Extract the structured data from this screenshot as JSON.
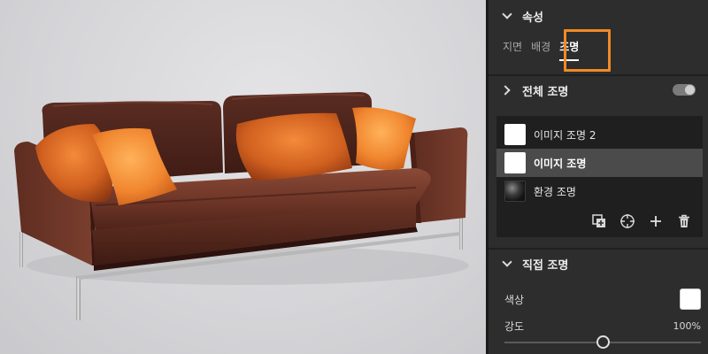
{
  "viewport": {
    "scene": "3d-sofa-preview",
    "background_color": "#d8d8db"
  },
  "panel": {
    "properties": {
      "title": "속성"
    },
    "tabs": [
      {
        "label": "지면",
        "active": false
      },
      {
        "label": "배경",
        "active": false
      },
      {
        "label": "조명",
        "active": true
      }
    ],
    "highlight_color": "#f08a24",
    "global_lighting": {
      "title": "전체 조명",
      "enabled": true
    },
    "lights": [
      {
        "label": "이미지 조명 2",
        "thumb": "white",
        "selected": false
      },
      {
        "label": "이미지 조명",
        "thumb": "white",
        "selected": true
      },
      {
        "label": "환경 조명",
        "thumb": "environment-sphere",
        "selected": false
      }
    ],
    "list_tools": [
      "add-layer-icon",
      "target-icon",
      "plus-icon",
      "trash-icon"
    ],
    "direct_light": {
      "title": "직접 조명",
      "color_label": "색상",
      "color_value": "#ffffff",
      "intensity_label": "강도",
      "intensity_value": "100%",
      "intensity_fraction": 0.5
    }
  }
}
